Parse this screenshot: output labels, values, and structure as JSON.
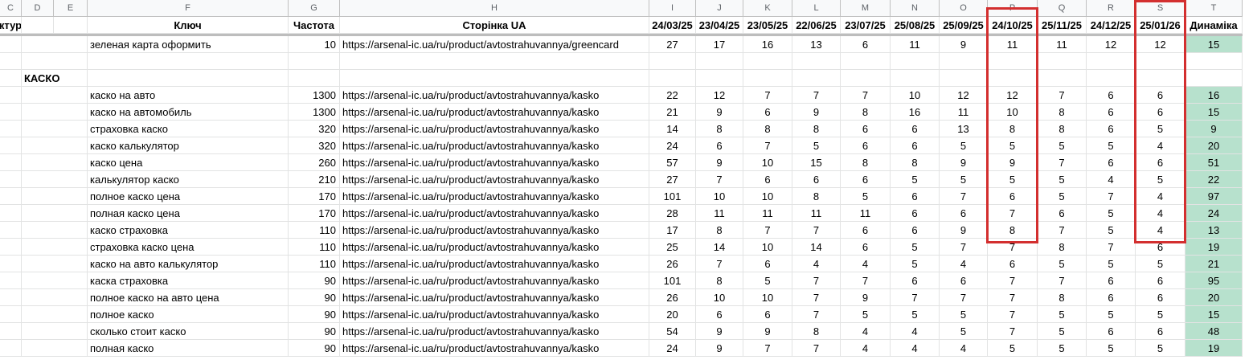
{
  "column_letters": [
    "C",
    "D",
    "E",
    "F",
    "G",
    "H",
    "I",
    "J",
    "K",
    "L",
    "M",
    "N",
    "O",
    "P",
    "Q",
    "R",
    "S",
    "T"
  ],
  "headers": {
    "c": "уктура",
    "f": "Ключ",
    "g": "Частота",
    "h": "Сторінка UA",
    "dates": [
      "24/03/25",
      "23/04/25",
      "23/05/25",
      "22/06/25",
      "23/07/25",
      "25/08/25",
      "25/09/25",
      "24/10/25",
      "25/11/25",
      "24/12/25",
      "25/01/26"
    ],
    "t": "Динаміка"
  },
  "rows": [
    {
      "section": "",
      "key": "зеленая карта оформить",
      "freq": "10",
      "url": "https://arsenal-ic.ua/ru/product/avtostrahuvannya/greencard",
      "pos": [
        "27",
        "17",
        "16",
        "13",
        "6",
        "11",
        "9",
        "11",
        "11",
        "12",
        "12"
      ],
      "dyn": "15"
    },
    {
      "section": "",
      "key": "",
      "freq": "",
      "url": "",
      "pos": [
        "",
        "",
        "",
        "",
        "",
        "",
        "",
        "",
        "",
        "",
        ""
      ],
      "dyn": ""
    },
    {
      "section": "КАСКО",
      "key": "",
      "freq": "",
      "url": "",
      "pos": [
        "",
        "",
        "",
        "",
        "",
        "",
        "",
        "",
        "",
        "",
        ""
      ],
      "dyn": ""
    },
    {
      "section": "",
      "key": "каско на авто",
      "freq": "1300",
      "url": "https://arsenal-ic.ua/ru/product/avtostrahuvannya/kasko",
      "pos": [
        "22",
        "12",
        "7",
        "7",
        "7",
        "10",
        "12",
        "12",
        "7",
        "6",
        "6"
      ],
      "dyn": "16"
    },
    {
      "section": "",
      "key": "каско на автомобиль",
      "freq": "1300",
      "url": "https://arsenal-ic.ua/ru/product/avtostrahuvannya/kasko",
      "pos": [
        "21",
        "9",
        "6",
        "9",
        "8",
        "16",
        "11",
        "10",
        "8",
        "6",
        "6"
      ],
      "dyn": "15"
    },
    {
      "section": "",
      "key": "страховка каско",
      "freq": "320",
      "url": "https://arsenal-ic.ua/ru/product/avtostrahuvannya/kasko",
      "pos": [
        "14",
        "8",
        "8",
        "8",
        "6",
        "6",
        "13",
        "8",
        "8",
        "6",
        "5"
      ],
      "dyn": "9"
    },
    {
      "section": "",
      "key": "каско калькулятор",
      "freq": "320",
      "url": "https://arsenal-ic.ua/ru/product/avtostrahuvannya/kasko",
      "pos": [
        "24",
        "6",
        "7",
        "5",
        "6",
        "6",
        "5",
        "5",
        "5",
        "5",
        "4"
      ],
      "dyn": "20"
    },
    {
      "section": "",
      "key": "каско цена",
      "freq": "260",
      "url": "https://arsenal-ic.ua/ru/product/avtostrahuvannya/kasko",
      "pos": [
        "57",
        "9",
        "10",
        "15",
        "8",
        "8",
        "9",
        "9",
        "7",
        "6",
        "6"
      ],
      "dyn": "51"
    },
    {
      "section": "",
      "key": "калькулятор каско",
      "freq": "210",
      "url": "https://arsenal-ic.ua/ru/product/avtostrahuvannya/kasko",
      "pos": [
        "27",
        "7",
        "6",
        "6",
        "6",
        "5",
        "5",
        "5",
        "5",
        "4",
        "5"
      ],
      "dyn": "22"
    },
    {
      "section": "",
      "key": "полное каско цена",
      "freq": "170",
      "url": "https://arsenal-ic.ua/ru/product/avtostrahuvannya/kasko",
      "pos": [
        "101",
        "10",
        "10",
        "8",
        "5",
        "6",
        "7",
        "6",
        "5",
        "7",
        "4"
      ],
      "dyn": "97"
    },
    {
      "section": "",
      "key": "полная каско цена",
      "freq": "170",
      "url": "https://arsenal-ic.ua/ru/product/avtostrahuvannya/kasko",
      "pos": [
        "28",
        "11",
        "11",
        "11",
        "11",
        "6",
        "6",
        "7",
        "6",
        "5",
        "4"
      ],
      "dyn": "24"
    },
    {
      "section": "",
      "key": "каско страховка",
      "freq": "110",
      "url": "https://arsenal-ic.ua/ru/product/avtostrahuvannya/kasko",
      "pos": [
        "17",
        "8",
        "7",
        "7",
        "6",
        "6",
        "9",
        "8",
        "7",
        "5",
        "4"
      ],
      "dyn": "13"
    },
    {
      "section": "",
      "key": "страховка каско цена",
      "freq": "110",
      "url": "https://arsenal-ic.ua/ru/product/avtostrahuvannya/kasko",
      "pos": [
        "25",
        "14",
        "10",
        "14",
        "6",
        "5",
        "7",
        "7",
        "8",
        "7",
        "6"
      ],
      "dyn": "19"
    },
    {
      "section": "",
      "key": "каско на авто калькулятор",
      "freq": "110",
      "url": "https://arsenal-ic.ua/ru/product/avtostrahuvannya/kasko",
      "pos": [
        "26",
        "7",
        "6",
        "4",
        "4",
        "5",
        "4",
        "6",
        "5",
        "5",
        "5"
      ],
      "dyn": "21"
    },
    {
      "section": "",
      "key": "каска страховка",
      "freq": "90",
      "url": "https://arsenal-ic.ua/ru/product/avtostrahuvannya/kasko",
      "pos": [
        "101",
        "8",
        "5",
        "7",
        "7",
        "6",
        "6",
        "7",
        "7",
        "6",
        "6"
      ],
      "dyn": "95"
    },
    {
      "section": "",
      "key": "полное каско на авто цена",
      "freq": "90",
      "url": "https://arsenal-ic.ua/ru/product/avtostrahuvannya/kasko",
      "pos": [
        "26",
        "10",
        "10",
        "7",
        "9",
        "7",
        "7",
        "7",
        "8",
        "6",
        "6"
      ],
      "dyn": "20"
    },
    {
      "section": "",
      "key": "полное каско",
      "freq": "90",
      "url": "https://arsenal-ic.ua/ru/product/avtostrahuvannya/kasko",
      "pos": [
        "20",
        "6",
        "6",
        "7",
        "5",
        "5",
        "5",
        "7",
        "5",
        "5",
        "5"
      ],
      "dyn": "15"
    },
    {
      "section": "",
      "key": "сколько стоит каско",
      "freq": "90",
      "url": "https://arsenal-ic.ua/ru/product/avtostrahuvannya/kasko",
      "pos": [
        "54",
        "9",
        "9",
        "8",
        "4",
        "4",
        "5",
        "7",
        "5",
        "6",
        "6"
      ],
      "dyn": "48"
    },
    {
      "section": "",
      "key": "полная каско",
      "freq": "90",
      "url": "https://arsenal-ic.ua/ru/product/avtostrahuvannya/kasko",
      "pos": [
        "24",
        "9",
        "7",
        "7",
        "4",
        "4",
        "4",
        "5",
        "5",
        "5",
        "5"
      ],
      "dyn": "19"
    }
  ]
}
